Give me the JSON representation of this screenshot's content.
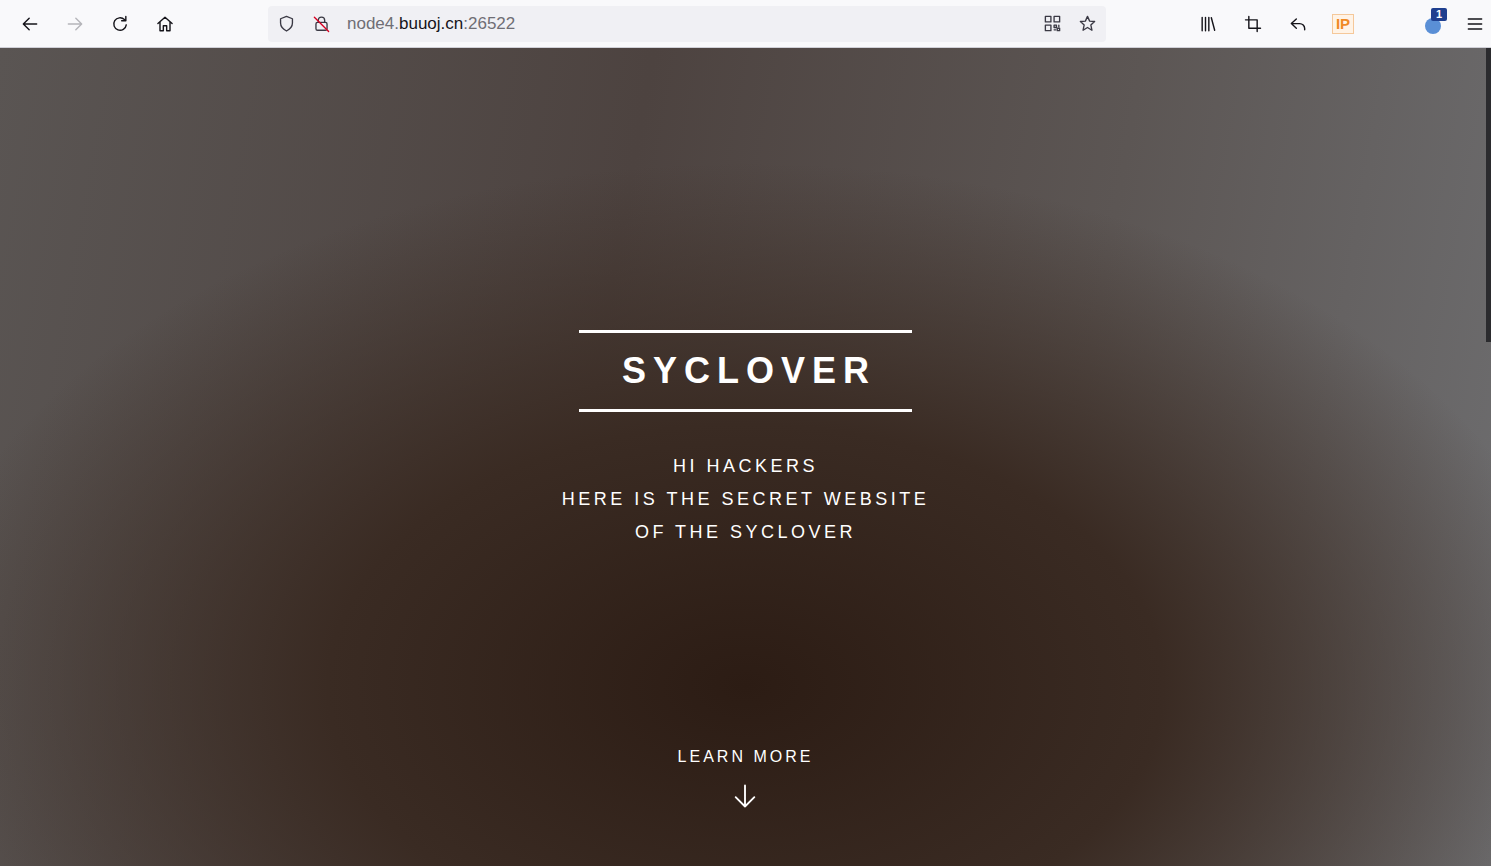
{
  "browser": {
    "nav": [
      {
        "kind": "back",
        "disabled": false
      },
      {
        "kind": "forward",
        "disabled": true
      },
      {
        "kind": "reload",
        "disabled": false
      },
      {
        "kind": "home",
        "disabled": false
      }
    ],
    "address": {
      "prefix": "node4.",
      "domain": "buuoj.cn",
      "suffix": ":26522"
    },
    "toolbar": [
      {
        "kind": "library",
        "text": ""
      },
      {
        "kind": "crop",
        "text": ""
      },
      {
        "kind": "reply",
        "text": ""
      },
      {
        "kind": "ip",
        "text": "IP"
      },
      {
        "kind": "extension",
        "text": "1"
      },
      {
        "kind": "menu",
        "text": ""
      }
    ]
  },
  "page": {
    "title": "SYCLOVER",
    "lines": [
      "HI HACKERS",
      "HERE IS THE SECRET WEBSITE",
      "OF THE SYCLOVER"
    ],
    "cta": "LEARN MORE"
  },
  "scrollbar": {
    "level": 0.36
  }
}
